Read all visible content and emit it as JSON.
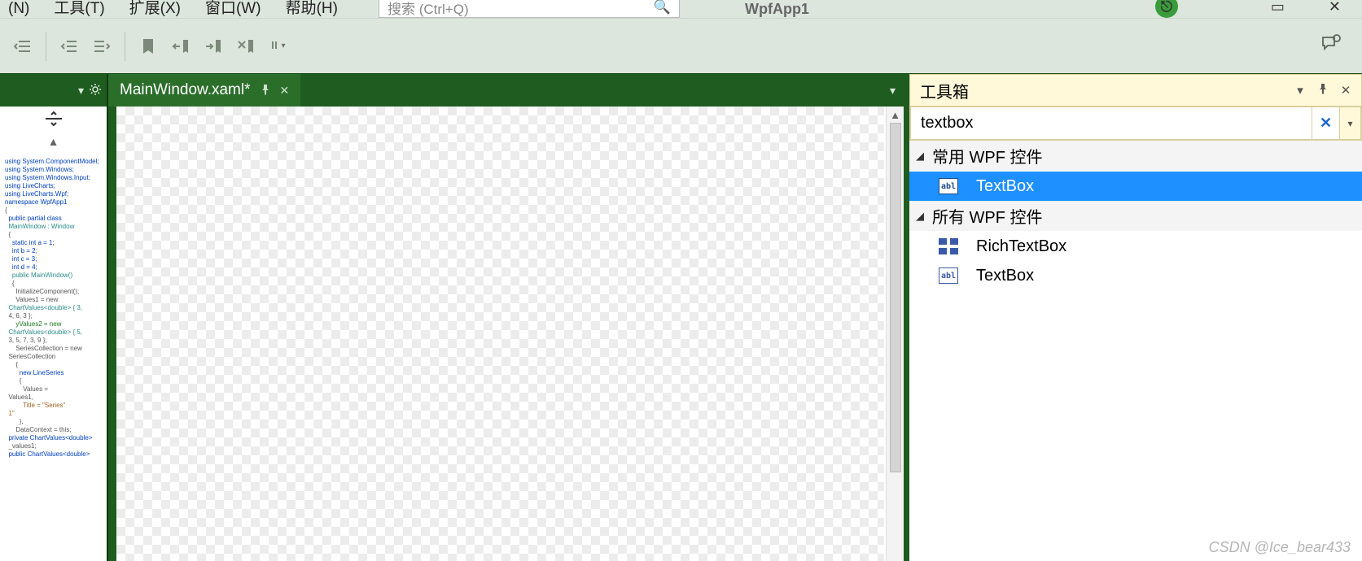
{
  "menu": {
    "items": [
      "(N)",
      "工具(T)",
      "扩展(X)",
      "窗口(W)",
      "帮助(H)"
    ],
    "search_placeholder": "搜索 (Ctrl+Q)",
    "app_name": "WpfApp1"
  },
  "document": {
    "tab_title": "MainWindow.xaml*"
  },
  "toolbox": {
    "title": "工具箱",
    "search_value": "textbox",
    "groups": [
      {
        "header": "常用 WPF 控件",
        "items": [
          {
            "label": "TextBox",
            "icon": "abl",
            "selected": true
          }
        ]
      },
      {
        "header": "所有 WPF 控件",
        "items": [
          {
            "label": "RichTextBox",
            "icon": "rtb",
            "selected": false
          },
          {
            "label": "TextBox",
            "icon": "abl",
            "selected": false
          }
        ]
      }
    ]
  },
  "code_thumb": {
    "lines": [
      {
        "t": "using System.ComponentModel;",
        "c": "kw-blue"
      },
      {
        "t": "using System.Windows;",
        "c": "kw-blue"
      },
      {
        "t": "using System.Windows.Input;",
        "c": "kw-blue"
      },
      {
        "t": "using LiveCharts;",
        "c": "kw-blue"
      },
      {
        "t": "using LiveCharts.Wpf;",
        "c": "kw-blue"
      },
      {
        "t": "namespace WpfApp1",
        "c": "kw-blue"
      },
      {
        "t": "{",
        "c": "kw-gray"
      },
      {
        "t": "  public partial class",
        "c": "kw-blue"
      },
      {
        "t": "  MainWindow : Window",
        "c": "kw-teal"
      },
      {
        "t": "  {",
        "c": "kw-gray"
      },
      {
        "t": "    static int a = 1;",
        "c": "kw-blue"
      },
      {
        "t": "    int b = 2;",
        "c": "kw-blue"
      },
      {
        "t": "    int c = 3;",
        "c": "kw-blue"
      },
      {
        "t": "    int d = 4;",
        "c": "kw-blue"
      },
      {
        "t": "    public MainWindow()",
        "c": "kw-teal"
      },
      {
        "t": "    {",
        "c": "kw-gray"
      },
      {
        "t": "      InitializeComponent();",
        "c": "kw-gray"
      },
      {
        "t": "",
        "c": "kw-gray"
      },
      {
        "t": "      Values1 = new",
        "c": "kw-gray"
      },
      {
        "t": "  ChartValues<double> { 3,",
        "c": "kw-teal"
      },
      {
        "t": "  4, 6, 3 };",
        "c": "kw-gray"
      },
      {
        "t": "      yValues2 = new",
        "c": "kw-green"
      },
      {
        "t": "  ChartValues<double> { 5,",
        "c": "kw-teal"
      },
      {
        "t": "  3, 5, 7, 3, 9 };",
        "c": "kw-gray"
      },
      {
        "t": "      SeriesCollection = new",
        "c": "kw-gray"
      },
      {
        "t": "  SeriesCollection",
        "c": "kw-gray"
      },
      {
        "t": "      {",
        "c": "kw-gray"
      },
      {
        "t": "        new LineSeries",
        "c": "kw-blue"
      },
      {
        "t": "        {",
        "c": "kw-gray"
      },
      {
        "t": "          Values =",
        "c": "kw-gray"
      },
      {
        "t": "  Values1,",
        "c": "kw-gray"
      },
      {
        "t": "          Title = \"Series\"",
        "c": "kw-brown"
      },
      {
        "t": "  1\"",
        "c": "kw-brown"
      },
      {
        "t": "        },",
        "c": "kw-gray"
      },
      {
        "t": "      DataContext = this;",
        "c": "kw-gray"
      },
      {
        "t": "",
        "c": "kw-gray"
      },
      {
        "t": "  private ChartValues<double>",
        "c": "kw-blue"
      },
      {
        "t": "  _values1;",
        "c": "kw-gray"
      },
      {
        "t": "  public ChartValues<double>",
        "c": "kw-blue"
      }
    ]
  },
  "watermark": "CSDN @Ice_bear433"
}
